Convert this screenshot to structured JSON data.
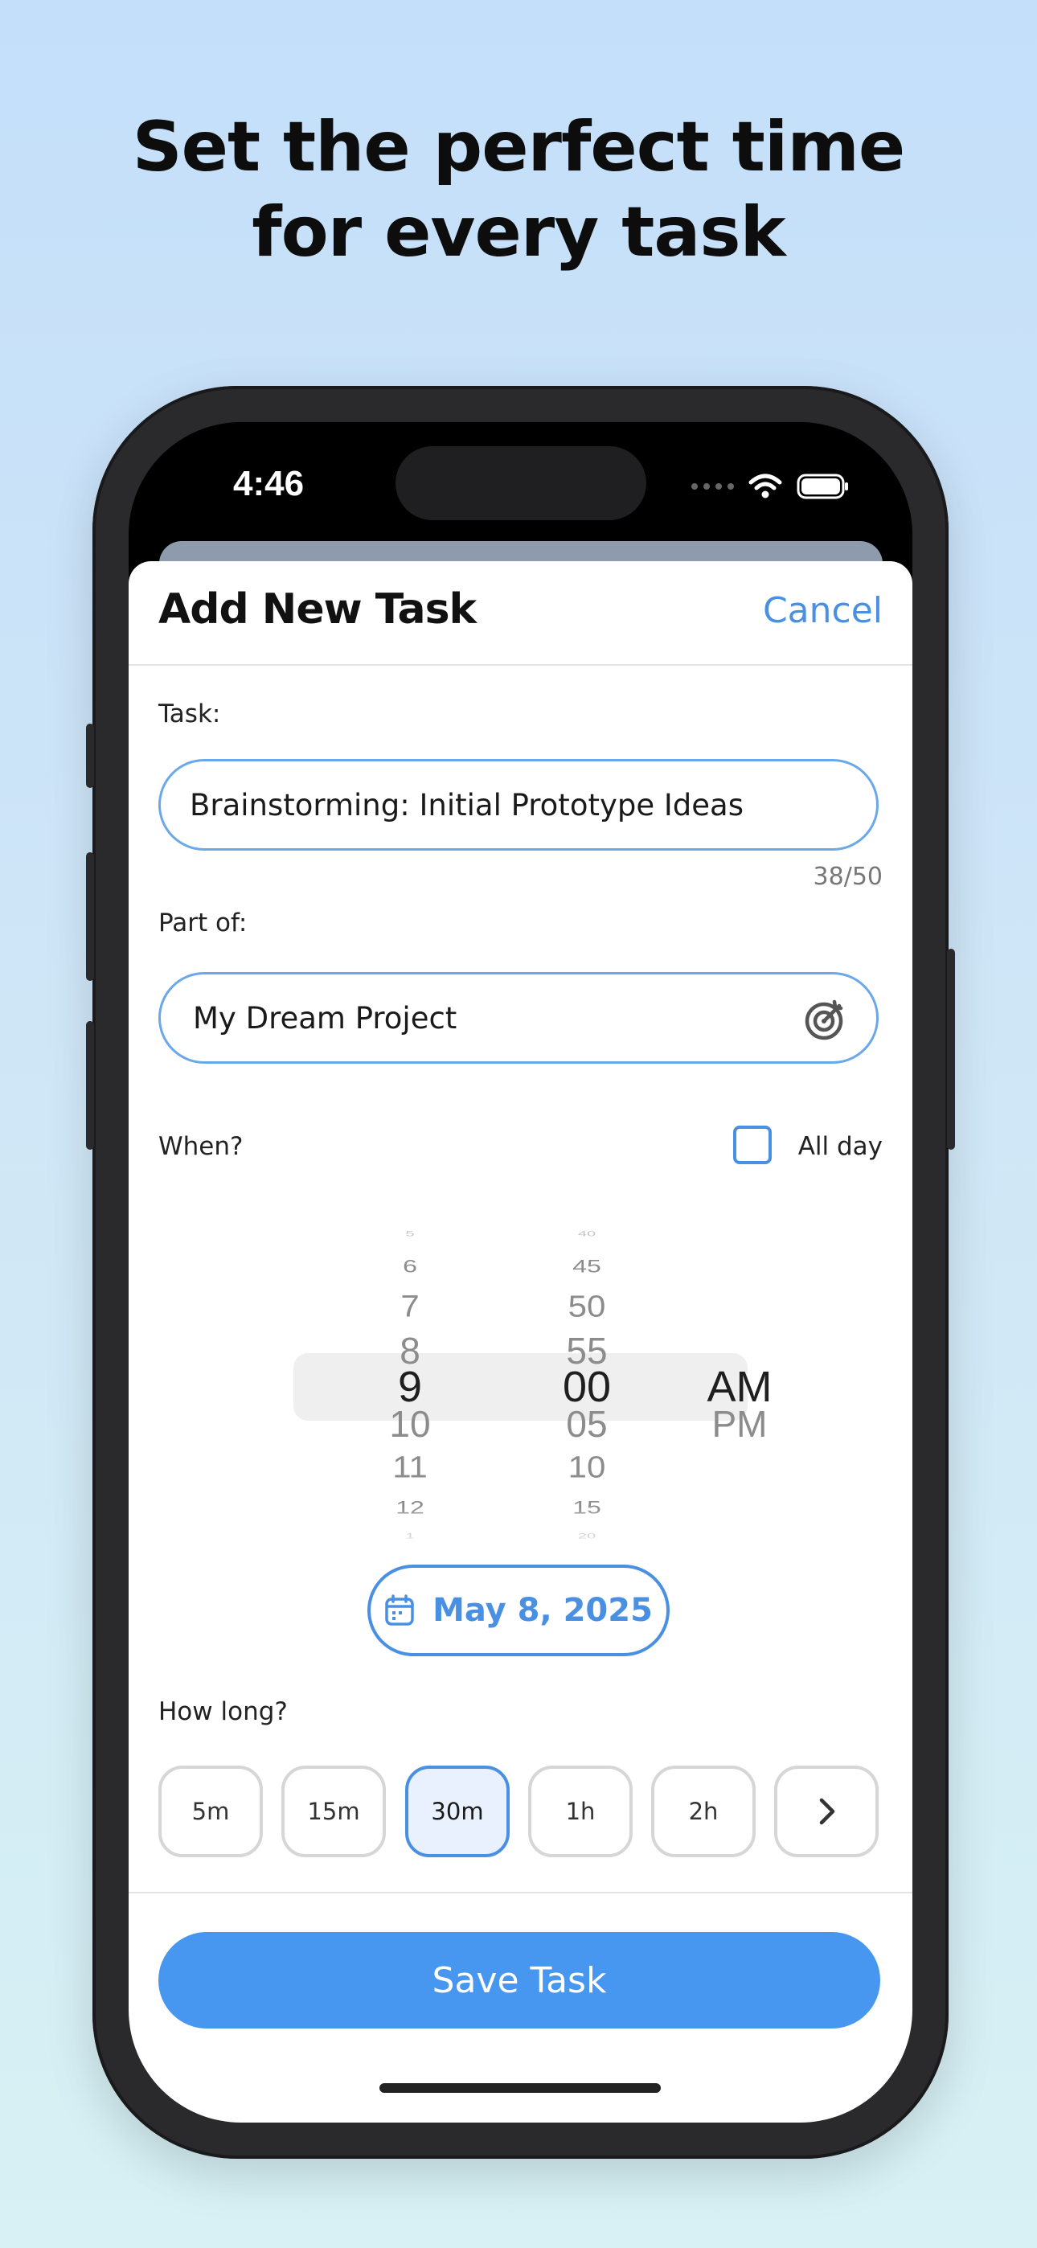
{
  "headline": {
    "line1": "Set the perfect time",
    "line2": "for every task"
  },
  "status_bar": {
    "time": "4:46"
  },
  "sheet": {
    "title": "Add New Task",
    "cancel_label": "Cancel"
  },
  "task": {
    "label": "Task:",
    "value": "Brainstorming: Initial Prototype Ideas",
    "counter": "38/50"
  },
  "part_of": {
    "label": "Part of:",
    "value": "My Dream Project",
    "icon": "target-edit-icon"
  },
  "when": {
    "label": "When?",
    "all_day_label": "All day",
    "all_day_checked": false
  },
  "picker": {
    "hours": [
      "5",
      "6",
      "7",
      "8",
      "9",
      "10",
      "11",
      "12",
      "1"
    ],
    "minutes": [
      "40",
      "45",
      "50",
      "55",
      "00",
      "05",
      "10",
      "15",
      "20"
    ],
    "ampm": [
      "AM",
      "PM"
    ],
    "selected": {
      "hour": "9",
      "minute": "00",
      "ampm": "AM"
    }
  },
  "date": {
    "label": "May 8, 2025",
    "icon": "calendar-icon"
  },
  "duration": {
    "label": "How long?",
    "options": [
      "5m",
      "15m",
      "30m",
      "1h",
      "2h"
    ],
    "selected": "30m",
    "more_icon": "chevron-right-icon"
  },
  "save_label": "Save Task",
  "colors": {
    "accent": "#4A90E2",
    "save": "#4796EF",
    "background_top": "#C4DFFA",
    "background_bottom": "#D7F1F4"
  }
}
